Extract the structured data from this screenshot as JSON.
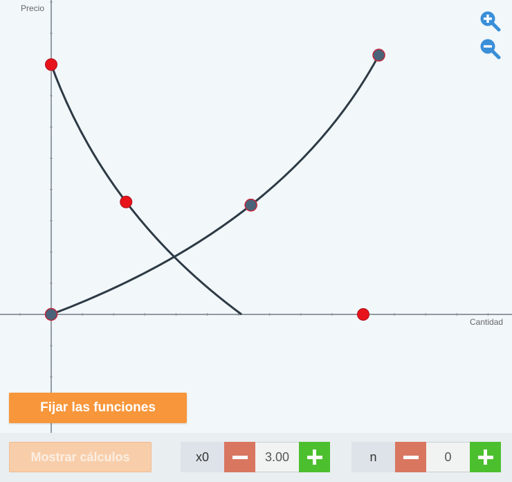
{
  "chart_data": {
    "type": "line",
    "xlabel": "Cantidad",
    "ylabel": "Precio",
    "demand_curve": {
      "points": [
        [
          0,
          8
        ],
        [
          2.4,
          3.6
        ],
        [
          6.1,
          0
        ]
      ],
      "handles": [
        [
          0,
          8
        ],
        [
          2.4,
          3.6
        ],
        [
          10,
          0
        ]
      ],
      "color": "#2d3a44"
    },
    "supply_curve": {
      "points": [
        [
          0,
          0
        ],
        [
          6.4,
          3.5
        ],
        [
          10.5,
          8.3
        ]
      ],
      "handles": [
        [
          0,
          0
        ],
        [
          6.4,
          3.5
        ],
        [
          10.5,
          8.3
        ]
      ],
      "color": "#2d3a44"
    },
    "handle_colors": {
      "demand": "#e8141b",
      "supply": "#4a6378",
      "stroke": "#c0263a"
    }
  },
  "zoom": {
    "in_icon": "zoom-in-icon",
    "out_icon": "zoom-out-icon",
    "color": "#3a8fd8"
  },
  "buttons": {
    "fix_label": "Fijar las funciones",
    "calc_label": "Mostrar cálculos"
  },
  "steppers": {
    "x0": {
      "label": "x0",
      "value": "3.00"
    },
    "n": {
      "label": "n",
      "value": "0"
    }
  },
  "colors": {
    "accent": "#f7963a",
    "minus": "#d97660",
    "plus": "#4cbf2e"
  }
}
